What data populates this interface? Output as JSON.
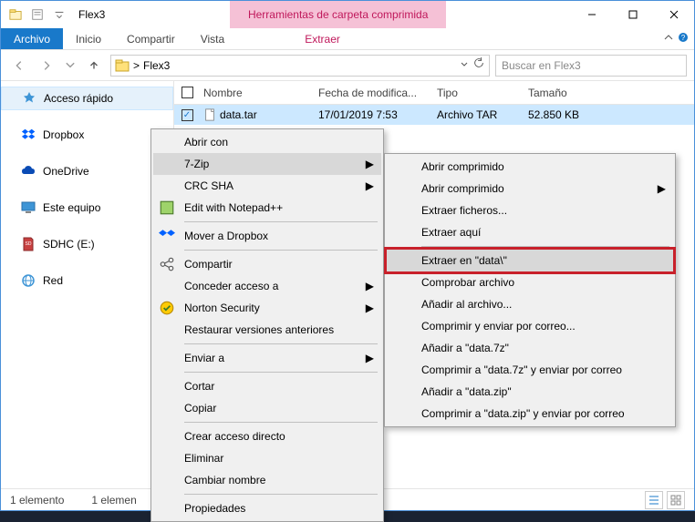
{
  "title": "Flex3",
  "ribbon_context_label": "Herramientas de carpeta comprimida",
  "ribbon": {
    "file": "Archivo",
    "home": "Inicio",
    "share": "Compartir",
    "view": "Vista",
    "extract": "Extraer"
  },
  "address": {
    "caret": ">",
    "path": "Flex3"
  },
  "search": {
    "placeholder": "Buscar en Flex3"
  },
  "sidebar": {
    "quick": "Acceso rápido",
    "dropbox": "Dropbox",
    "onedrive": "OneDrive",
    "thispc": "Este equipo",
    "sdhc": "SDHC (E:)",
    "network": "Red"
  },
  "columns": {
    "name": "Nombre",
    "date": "Fecha de modifica...",
    "type": "Tipo",
    "size": "Tamaño"
  },
  "file": {
    "name": "data.tar",
    "date": "17/01/2019 7:53",
    "type": "Archivo TAR",
    "size": "52.850 KB"
  },
  "status": {
    "count": "1 elemento",
    "selected": "1 elemen"
  },
  "ctx1": {
    "open_with": "Abrir con",
    "sevenzip": "7-Zip",
    "crc": "CRC SHA",
    "notepad": "Edit with Notepad++",
    "move_dropbox": "Mover a Dropbox",
    "share": "Compartir",
    "grant": "Conceder acceso a",
    "norton": "Norton Security",
    "restore": "Restaurar versiones anteriores",
    "sendto": "Enviar a",
    "cut": "Cortar",
    "copy": "Copiar",
    "shortcut": "Crear acceso directo",
    "delete": "Eliminar",
    "rename": "Cambiar nombre",
    "properties": "Propiedades"
  },
  "ctx2": {
    "open1": "Abrir comprimido",
    "open2": "Abrir comprimido",
    "extract_files": "Extraer ficheros...",
    "extract_here": "Extraer aquí",
    "extract_to": "Extraer en \"data\\\"",
    "test": "Comprobar archivo",
    "add": "Añadir al archivo...",
    "compress_email": "Comprimir y enviar por correo...",
    "add_7z": "Añadir a \"data.7z\"",
    "compress_7z_email": "Comprimir a \"data.7z\" y enviar por correo",
    "add_zip": "Añadir a \"data.zip\"",
    "compress_zip_email": "Comprimir a \"data.zip\" y enviar por correo"
  }
}
